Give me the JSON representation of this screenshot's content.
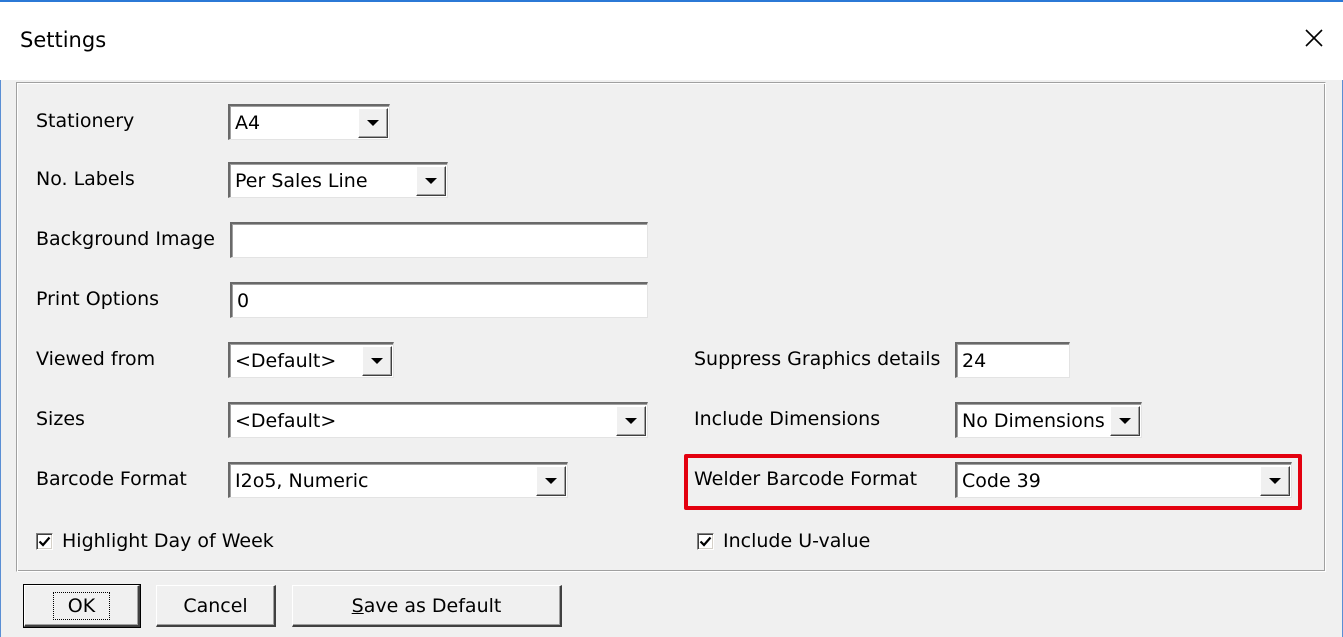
{
  "window": {
    "title": "Settings",
    "close_icon": "close-icon"
  },
  "fields": {
    "stationery": {
      "label": "Stationery",
      "value": "A4"
    },
    "no_labels": {
      "label": "No. Labels",
      "value": "Per Sales Line"
    },
    "background_image": {
      "label": "Background Image",
      "value": ""
    },
    "print_options": {
      "label": "Print Options",
      "value": "0"
    },
    "viewed_from": {
      "label": "Viewed from",
      "value": "<Default>"
    },
    "sizes": {
      "label": "Sizes",
      "value": "<Default>"
    },
    "barcode_format": {
      "label": "Barcode Format",
      "value": "I2o5, Numeric"
    },
    "suppress_graphics": {
      "label": "Suppress Graphics details",
      "value": "24"
    },
    "include_dimensions": {
      "label": "Include Dimensions",
      "value": "No Dimensions"
    },
    "welder_barcode_format": {
      "label": "Welder Barcode Format",
      "value": "Code 39"
    }
  },
  "checkboxes": {
    "highlight_day": {
      "label": "Highlight Day of Week",
      "checked": true
    },
    "include_uvalue": {
      "label": "Include U-value",
      "checked": true
    }
  },
  "buttons": {
    "ok": "OK",
    "cancel": "Cancel",
    "save_default_first": "S",
    "save_default_rest": "ave as Default"
  },
  "colors": {
    "highlight": "#e3000f",
    "title_edge": "#2b79d6"
  }
}
